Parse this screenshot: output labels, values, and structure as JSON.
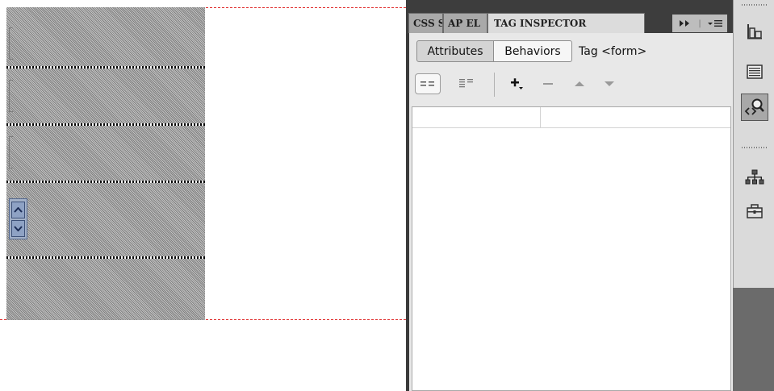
{
  "panel": {
    "tabs": [
      {
        "label": "CSS S",
        "active": false
      },
      {
        "label": "AP EL",
        "active": false
      },
      {
        "label": "TAG INSPECTOR",
        "active": true
      }
    ],
    "segments": {
      "attributes_label": "Attributes",
      "behaviors_label": "Behaviors",
      "tag_label": "Tag <form>"
    },
    "toolbar": {
      "show_set_events_icon": "show-set-events-icon",
      "show_all_events_icon": "show-all-events-icon",
      "add_behavior_icon": "add-behavior-icon",
      "remove_behavior_icon": "remove-behavior-icon",
      "move_up_icon": "move-up-icon",
      "move_down_icon": "move-down-icon"
    }
  },
  "strip": {
    "icons": [
      "align-icon",
      "templates-icon",
      "tag-inspector-icon",
      "site-map-icon",
      "toolbox-icon"
    ]
  },
  "colors": {
    "panel_bg": "#3a3a3a",
    "panel_body": "#e8e8e8",
    "selection_red": "#e03030",
    "strip_bg": "#6b6b6b"
  }
}
